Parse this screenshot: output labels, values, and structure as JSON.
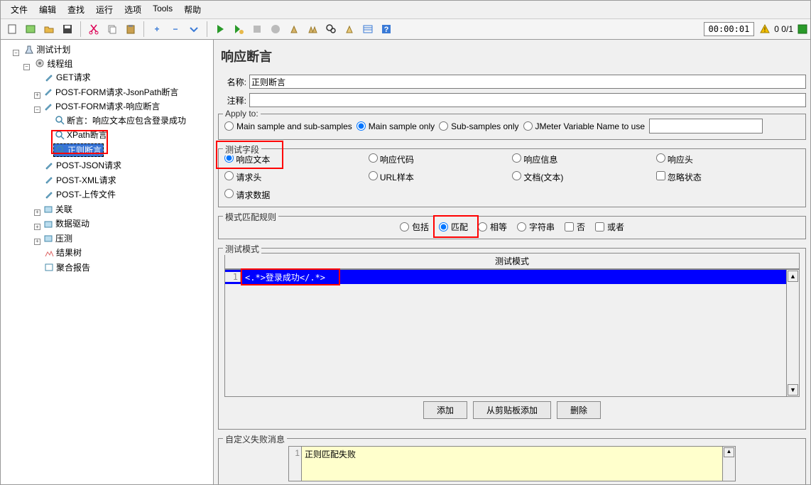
{
  "menu": [
    "文件",
    "编辑",
    "查找",
    "运行",
    "选项",
    "Tools",
    "帮助"
  ],
  "timer": "00:00:01",
  "status_count": "0  0/1",
  "tree": {
    "root": "测试计划",
    "group": "线程组",
    "items": [
      "GET请求",
      "POST-FORM请求-JsonPath断言",
      "POST-FORM请求-响应断言",
      "POST-JSON请求",
      "POST-XML请求",
      "POST-上传文件",
      "关联",
      "数据驱动",
      "压测",
      "结果树",
      "聚合报告"
    ],
    "sub3": [
      "断言：响应文本应包含登录成功",
      "XPath断言",
      "正则断言"
    ]
  },
  "panel_title": "响应断言",
  "name_label": "名称:",
  "name_value": "正则断言",
  "comment_label": "注释:",
  "comment_value": "",
  "apply": {
    "legend": "Apply to:",
    "opts": [
      "Main sample and sub-samples",
      "Main sample only",
      "Sub-samples only",
      "JMeter Variable Name to use"
    ]
  },
  "field": {
    "legend": "测试字段",
    "opts": [
      "响应文本",
      "响应代码",
      "响应信息",
      "响应头",
      "请求头",
      "URL样本",
      "文档(文本)",
      "忽略状态",
      "请求数据"
    ]
  },
  "rule": {
    "legend": "模式匹配规则",
    "opts": [
      "包括",
      "匹配",
      "相等",
      "字符串",
      "否",
      "或者"
    ]
  },
  "pattern": {
    "legend": "测试模式",
    "header": "测试模式",
    "row_no": "1",
    "row_val": "<.*>登录成功</.*>"
  },
  "btns": [
    "添加",
    "从剪贴板添加",
    "删除"
  ],
  "fail": {
    "legend": "自定义失败消息",
    "row_no": "1",
    "row_val": "正则匹配失败"
  }
}
